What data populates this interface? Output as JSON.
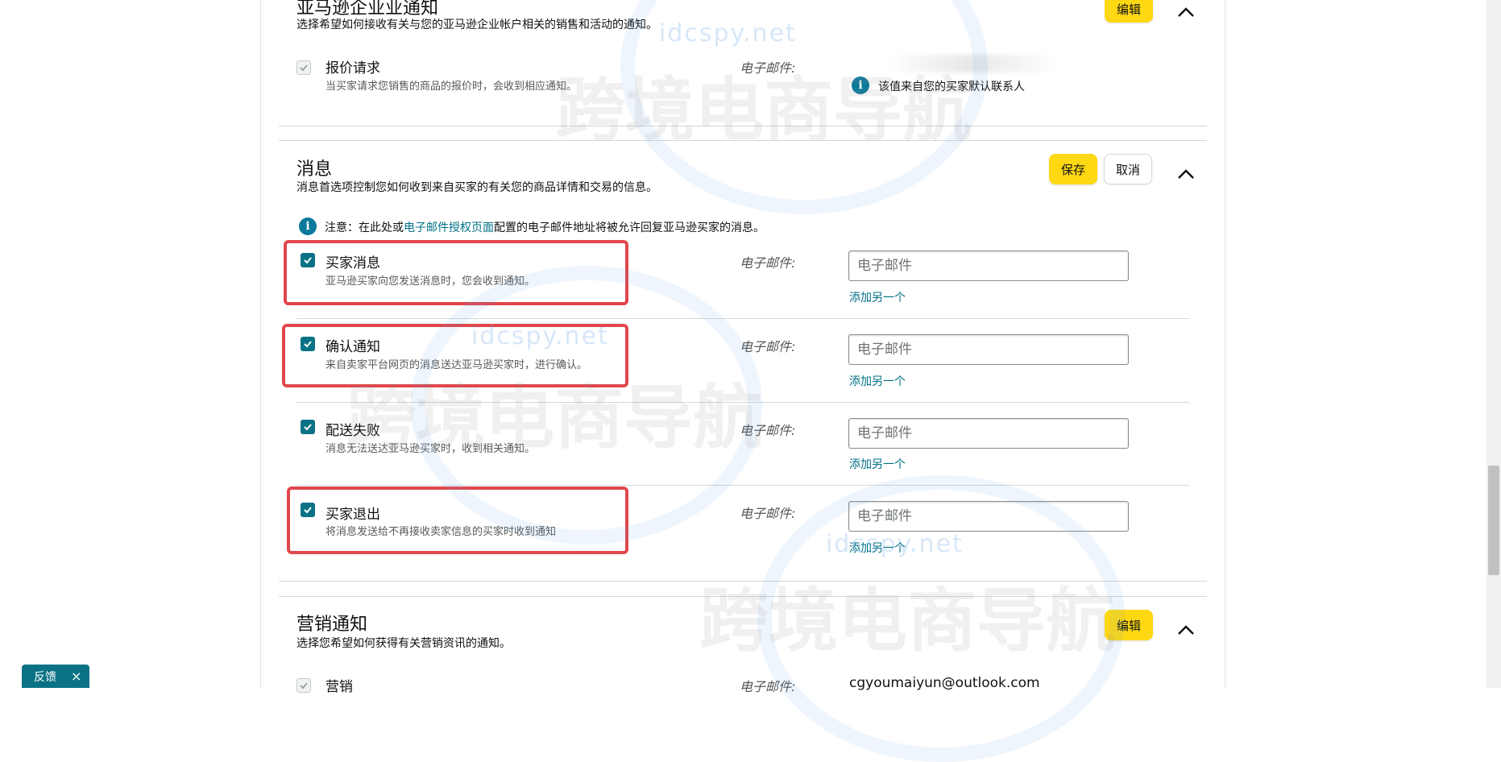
{
  "watermark": {
    "site": "idcspy.net",
    "brand": "跨境电商导航"
  },
  "section_business": {
    "title": "亚马逊企业业通知",
    "subtitle": "选择希望如何接收有关与您的亚马逊企业帐户相关的销售和活动的通知。",
    "edit_label": "编辑",
    "item": {
      "title": "报价请求",
      "desc": "当买家请求您销售的商品的报价时，会收到相应通知。",
      "email_label": "电子邮件:",
      "info_text": "该值来自您的买家默认联系人"
    }
  },
  "section_messages": {
    "title": "消息",
    "subtitle": "消息首选项控制您如何收到来自买家的有关您的商品详情和交易的信息。",
    "save_label": "保存",
    "cancel_label": "取消",
    "notice_prefix": "注意：在此处或",
    "notice_link": "电子邮件授权页面",
    "notice_suffix": "配置的电子邮件地址将被允许回复亚马逊买家的消息。",
    "items": [
      {
        "title": "买家消息",
        "desc": "亚马逊买家向您发送消息时，您会收到通知。",
        "email_label": "电子邮件:",
        "placeholder": "电子邮件",
        "add_link": "添加另一个",
        "checked": true
      },
      {
        "title": "确认通知",
        "desc": "来自卖家平台网页的消息送达亚马逊买家时，进行确认。",
        "email_label": "电子邮件:",
        "placeholder": "电子邮件",
        "add_link": "添加另一个",
        "checked": true
      },
      {
        "title": "配送失败",
        "desc": "消息无法送达亚马逊买家时，收到相关通知。",
        "email_label": "电子邮件:",
        "placeholder": "电子邮件",
        "add_link": "添加另一个",
        "checked": true
      },
      {
        "title": "买家退出",
        "desc": "将消息发送给不再接收卖家信息的买家时收到通知",
        "email_label": "电子邮件:",
        "placeholder": "电子邮件",
        "add_link": "添加另一个",
        "checked": true
      }
    ]
  },
  "section_marketing": {
    "title": "营销通知",
    "subtitle": "选择您希望如何获得有关营销资讯的通知。",
    "edit_label": "编辑",
    "item": {
      "title": "营销",
      "email_label": "电子邮件:",
      "email_value": "cgyoumaiyun@outlook.com"
    }
  },
  "feedback": {
    "label": "反馈",
    "close": "×"
  },
  "colors": {
    "accent_teal": "#0b7285",
    "button_yellow": "#ffd814",
    "highlight_red": "#e0474c",
    "link": "#007185"
  }
}
